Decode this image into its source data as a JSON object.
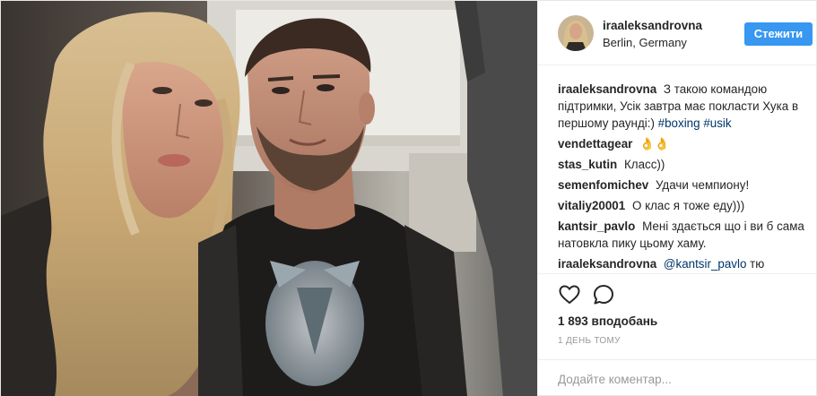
{
  "post": {
    "username": "iraaleksandrovna",
    "location": "Berlin, Germany",
    "follow_label": "Стежити",
    "likes": "1 893 вподобань",
    "timestamp": "1 ДЕНЬ ТОМУ",
    "comment_placeholder": "Додайте коментар..."
  },
  "comments": [
    {
      "user": "iraaleksandrovna",
      "text": "З такою командою підтримки, Усік завтра має покласти Хука в першому раунді:)",
      "tags": [
        "#boxing",
        "#usik"
      ]
    },
    {
      "user": "vendettagear",
      "text": "👌👌"
    },
    {
      "user": "stas_kutin",
      "text": "Класс))"
    },
    {
      "user": "semenfomichev",
      "text": "Удачи чемпиону!"
    },
    {
      "user": "vitaliy20001",
      "text": "О клас я тоже еду)))"
    },
    {
      "user": "kantsir_pavlo",
      "text": "Мені здається що і ви б сама натовкла пику цьому хаму."
    },
    {
      "user": "iraaleksandrovna",
      "mention": "@kantsir_pavlo",
      "text": "тю"
    }
  ],
  "icons": {
    "like": "heart-icon",
    "comment": "comment-bubble-icon"
  },
  "colors": {
    "follow_button": "#3897f0",
    "link": "#003569",
    "muted": "#999999"
  }
}
